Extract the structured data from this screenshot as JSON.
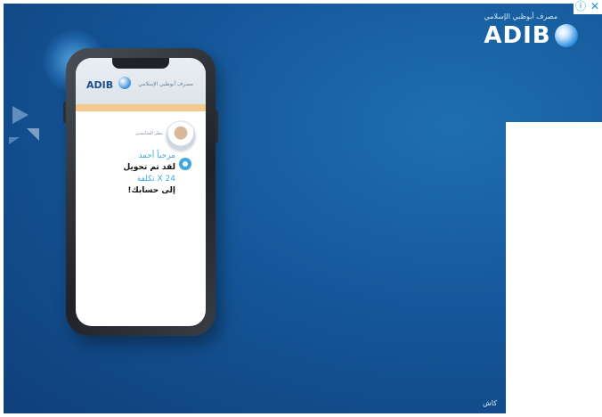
{
  "ad": {
    "brand_arabic": "مصرف أبوظبي الإسلامي",
    "brand_name": "ADIB",
    "adchoices_info": "ⓘ",
    "adchoices_close": "✕",
    "phone": {
      "app_logo": "ADIB",
      "app_brand_arabic": "مصرف أبوظبي الإسلامي",
      "agent_name": "مطر الشامسي",
      "message": {
        "line1": "مرحباً أحمد",
        "line2": "لقد تم تحويل",
        "line3": "24 X تكلفة",
        "line4": "إلى حسابك!"
      }
    },
    "footer": "كاش"
  },
  "colors": {
    "background": "#15579a",
    "accent": "#f3c98d",
    "highlight": "#3fa7e0"
  }
}
